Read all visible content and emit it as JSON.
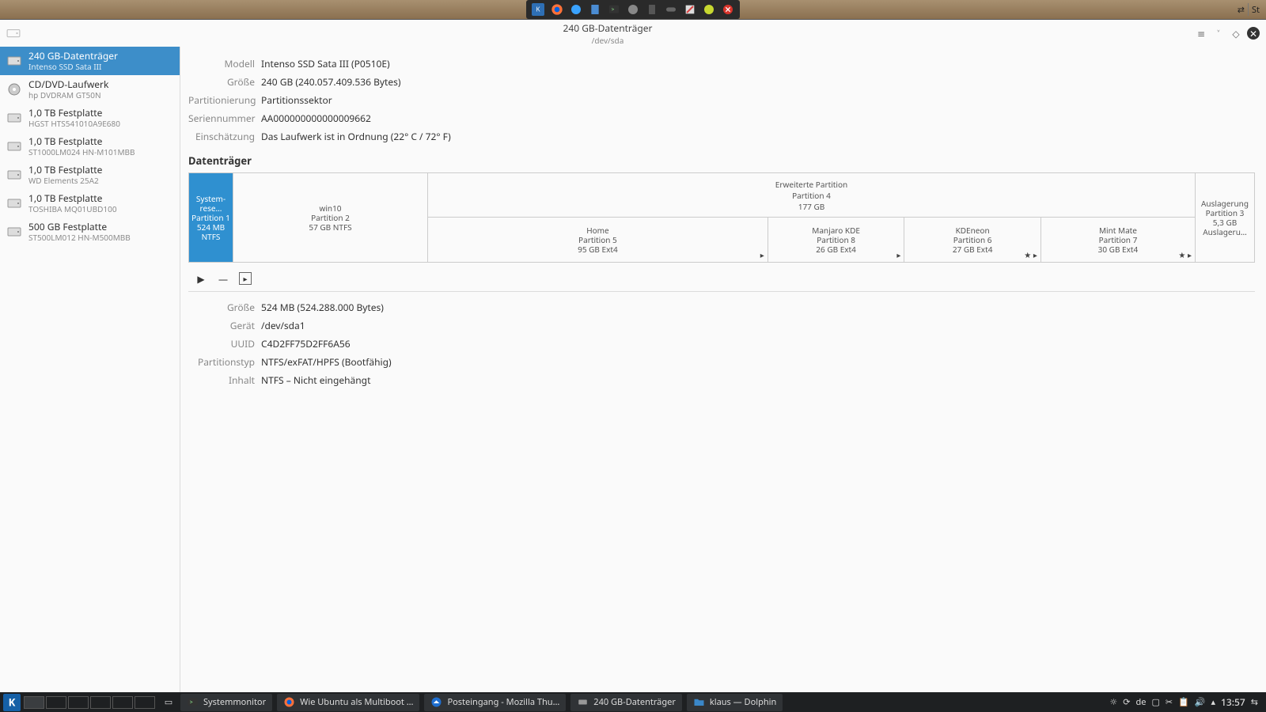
{
  "top_tray_icons": [
    "kde",
    "firefox",
    "chat",
    "notes",
    "terminal",
    "globe",
    "calc",
    "controller",
    "editor",
    "paint",
    "close"
  ],
  "top_right": {
    "label": "St"
  },
  "window": {
    "title": "240 GB-Datenträger",
    "subtitle": "/dev/sda"
  },
  "sidebar": {
    "devices": [
      {
        "name": "240 GB-Datenträger",
        "sub": "Intenso  SSD Sata III",
        "icon": "hdd",
        "selected": true
      },
      {
        "name": "CD/DVD-Laufwerk",
        "sub": "hp       DVDRAM GT50N",
        "icon": "optical"
      },
      {
        "name": "1,0 TB Festplatte",
        "sub": "HGST HTS541010A9E680",
        "icon": "hdd"
      },
      {
        "name": "1,0 TB Festplatte",
        "sub": "ST1000LM024 HN-M101MBB",
        "icon": "hdd"
      },
      {
        "name": "1,0 TB Festplatte",
        "sub": "WD Elements 25A2",
        "icon": "hdd"
      },
      {
        "name": "1,0 TB Festplatte",
        "sub": "TOSHIBA MQ01UBD100",
        "icon": "hdd"
      },
      {
        "name": "500 GB Festplatte",
        "sub": "ST500LM012 HN-M500MBB",
        "icon": "hdd"
      }
    ]
  },
  "info": [
    {
      "label": "Modell",
      "value": "Intenso  SSD Sata III (P0510E)"
    },
    {
      "label": "Größe",
      "value": "240 GB (240.057.409.536 Bytes)"
    },
    {
      "label": "Partitionierung",
      "value": "Partitionssektor"
    },
    {
      "label": "Seriennummer",
      "value": "AA000000000000009662"
    },
    {
      "label": "Einschätzung",
      "value": "Das Laufwerk ist in Ordnung (22° C / 72° F)"
    }
  ],
  "volumes_heading": "Datenträger",
  "partmap": {
    "p1": {
      "name": "System-rese…",
      "part": "Partition 1",
      "size": "524 MB NTFS"
    },
    "p2": {
      "name": "win10",
      "part": "Partition 2",
      "size": "57 GB NTFS"
    },
    "ext": {
      "name": "Erweiterte Partition",
      "part": "Partition 4",
      "size": "177 GB"
    },
    "p5": {
      "name": "Home",
      "part": "Partition 5",
      "size": "95 GB Ext4",
      "mark": "▸"
    },
    "p8": {
      "name": "Manjaro KDE",
      "part": "Partition 8",
      "size": "26 GB Ext4",
      "mark": "▸"
    },
    "p6": {
      "name": "KDEneon",
      "part": "Partition 6",
      "size": "27 GB Ext4",
      "mark": "★ ▸"
    },
    "p7": {
      "name": "Mint Mate",
      "part": "Partition 7",
      "size": "30 GB Ext4",
      "mark": "★ ▸"
    },
    "p3": {
      "name": "Auslagerung",
      "part": "Partition 3",
      "size": "5,3 GB Auslageru…"
    }
  },
  "detail": [
    {
      "label": "Größe",
      "value": "524 MB (524.288.000 Bytes)"
    },
    {
      "label": "Gerät",
      "value": "/dev/sda1"
    },
    {
      "label": "UUID",
      "value": "C4D2FF75D2FF6A56"
    },
    {
      "label": "Partitionstyp",
      "value": "NTFS/exFAT/HPFS (Bootfähig)"
    },
    {
      "label": "Inhalt",
      "value": "NTFS – Nicht eingehängt"
    }
  ],
  "taskbar": {
    "apps": [
      {
        "icon": "terminal",
        "label": "Systemmonitor"
      },
      {
        "icon": "firefox",
        "label": "Wie Ubuntu als Multiboot …"
      },
      {
        "icon": "thunderbird",
        "label": "Posteingang - Mozilla Thu…"
      },
      {
        "icon": "disks",
        "label": "240 GB-Datenträger"
      },
      {
        "icon": "folder",
        "label": "klaus — Dolphin"
      }
    ],
    "lang": "de",
    "clock": "13:57"
  }
}
